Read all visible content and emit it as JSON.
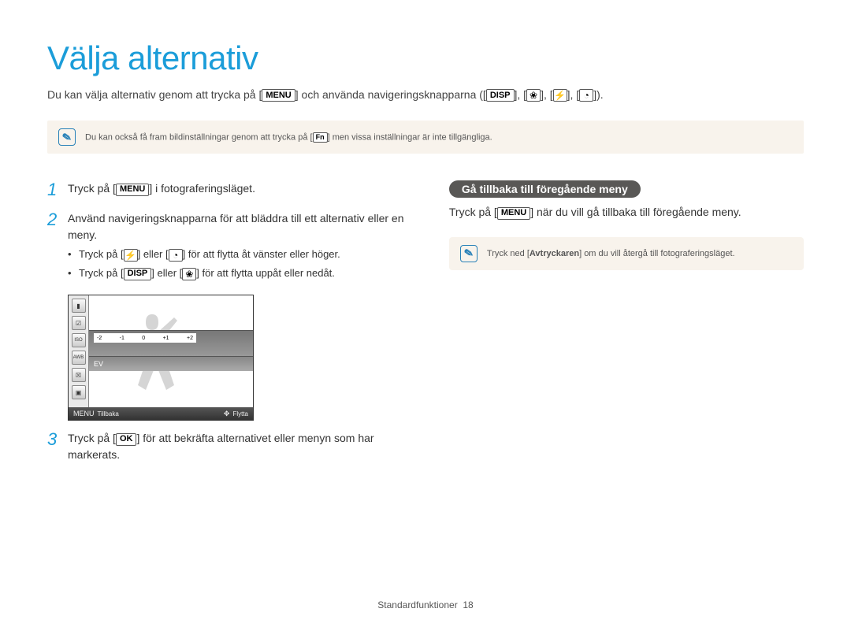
{
  "title": "Välja alternativ",
  "intro": {
    "prefix": "Du kan välja alternativ genom att trycka på [",
    "menu_label": "MENU",
    "mid": "] och använda navigeringsknapparna ([",
    "disp_label": "DISP",
    "sep": "], [",
    "suffix": "])."
  },
  "buttons": {
    "menu": "MENU",
    "disp": "DISP",
    "fn": "Fn",
    "ok": "OK"
  },
  "icon_glyphs": {
    "macro": "❀",
    "flash": "⚡",
    "timer": "◔"
  },
  "note_top": {
    "pre": "Du kan också få fram bildinställningar genom att trycka på [",
    "post": "] men vissa inställningar är inte tillgängliga."
  },
  "steps": {
    "s1": {
      "num": "1",
      "pre": "Tryck på [",
      "post": "] i fotograferingsläget."
    },
    "s2": {
      "num": "2",
      "main": "Använd navigeringsknapparna för att bläddra till ett alternativ eller en meny.",
      "b1_pre": "Tryck på [",
      "b1_mid": "] eller [",
      "b1_post": "] för att flytta åt vänster eller höger.",
      "b2_pre": "Tryck på [",
      "b2_mid": "] eller [",
      "b2_post": "] för att flytta uppåt eller nedåt."
    },
    "s3": {
      "num": "3",
      "pre": "Tryck på [",
      "post": "] för att bekräfta alternativet eller menyn som har markerats."
    }
  },
  "preview": {
    "ev_ticks": [
      "-2",
      "-1",
      "0",
      "+1",
      "+2"
    ],
    "ev_label": "EV",
    "footer_menu": "MENU",
    "footer_back": "Tillbaka",
    "footer_move": "Flytta",
    "side_items": [
      "▮",
      "☑",
      "ISO",
      "AWB",
      "☒",
      "▣"
    ]
  },
  "right": {
    "pill": "Gå tillbaka till föregående meny",
    "text_pre": "Tryck på [",
    "text_post": "] när du vill gå tillbaka till föregående meny.",
    "note_pre": "Tryck ned [",
    "note_bold": "Avtryckaren",
    "note_post": "] om du vill återgå till fotograferingsläget."
  },
  "footer": {
    "section": "Standardfunktioner",
    "page": "18"
  }
}
